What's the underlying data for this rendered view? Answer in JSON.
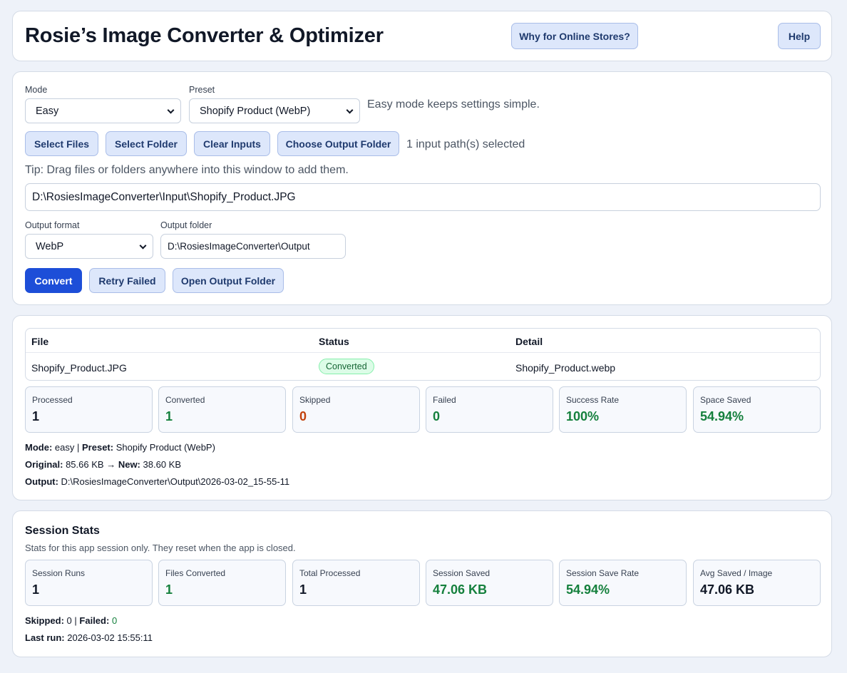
{
  "header": {
    "title": "Rosie’s Image Converter & Optimizer",
    "why_button": "Why for Online Stores?",
    "help_button": "Help"
  },
  "input": {
    "mode_label": "Mode",
    "mode_value": "Easy",
    "preset_label": "Preset",
    "preset_value": "Shopify Product (WebP)",
    "mode_hint": "Easy mode keeps settings simple.",
    "select_files_button": "Select Files",
    "select_folder_button": "Select Folder",
    "clear_inputs_button": "Clear Inputs",
    "choose_output_button": "Choose Output Folder",
    "selection_status": "1 input path(s) selected",
    "tip": "Tip: Drag files or folders anywhere into this window to add them.",
    "input_paths": "D:\\RosiesImageConverter\\Input\\Shopify_Product.JPG",
    "output_format_label": "Output format",
    "output_format_value": "WebP",
    "output_folder_label": "Output folder",
    "output_folder_value": "D:\\RosiesImageConverter\\Output",
    "convert_button": "Convert",
    "retry_button": "Retry Failed",
    "open_output_button": "Open Output Folder"
  },
  "results": {
    "columns": [
      "File",
      "Status",
      "Detail"
    ],
    "rows": [
      {
        "file": "Shopify_Product.JPG",
        "status": "Converted",
        "detail": "Shopify_Product.webp"
      }
    ],
    "stats": [
      {
        "label": "Processed",
        "value": "1"
      },
      {
        "label": "Converted",
        "value": "1"
      },
      {
        "label": "Skipped",
        "value": "0"
      },
      {
        "label": "Failed",
        "value": "0"
      },
      {
        "label": "Success Rate",
        "value": "100%"
      },
      {
        "label": "Space Saved",
        "value": "54.94%"
      }
    ],
    "summary": {
      "mode_key": "Mode:",
      "mode_val": "easy",
      "sep": "|",
      "preset_key": "Preset:",
      "preset_val": "Shopify Product (WebP)",
      "original_key": "Original:",
      "original_val": "85.66 KB",
      "arrow": "→",
      "new_key": "New:",
      "new_val": "38.60 KB",
      "output_key": "Output:",
      "output_val": "D:\\RosiesImageConverter\\Output\\2026-03-02_15-55-11"
    }
  },
  "session": {
    "title": "Session Stats",
    "subtitle": "Stats for this app session only. They reset when the app is closed.",
    "stats": [
      {
        "label": "Session Runs",
        "value": "1"
      },
      {
        "label": "Files Converted",
        "value": "1"
      },
      {
        "label": "Total Processed",
        "value": "1"
      },
      {
        "label": "Session Saved",
        "value": "47.06 KB"
      },
      {
        "label": "Session Save Rate",
        "value": "54.94%"
      },
      {
        "label": "Avg Saved / Image",
        "value": "47.06 KB"
      }
    ],
    "skipped_key": "Skipped:",
    "skipped_val": "0",
    "sep": "|",
    "failed_key": "Failed:",
    "failed_val": "0",
    "last_run_key": "Last run:",
    "last_run_val": "2026-03-02 15:55:11"
  },
  "colors": {
    "accent": "#1d4ed8",
    "success": "#15803d",
    "warning": "#c2410c",
    "background": "#eef2f9"
  }
}
